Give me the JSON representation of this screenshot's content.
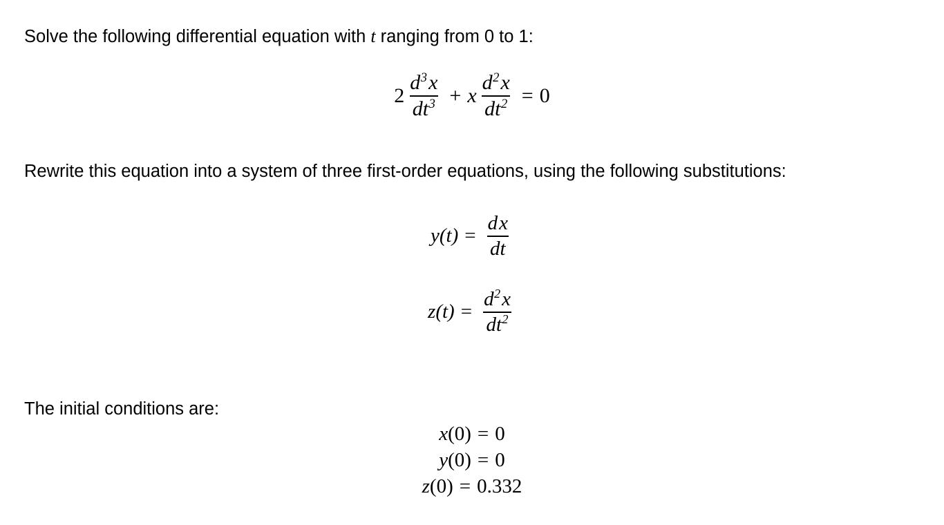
{
  "document": {
    "background_color": "#ffffff",
    "text_color": "#000000",
    "intro": {
      "before_var": "Solve the following differential equation with ",
      "variable": "t",
      "after_var": " ranging from 0 to 1:"
    },
    "main_equation": {
      "coefficient": "2",
      "term1": {
        "numerator_d": "d",
        "numerator_exp": "3",
        "numerator_var": "x",
        "denominator_dt": "dt",
        "denominator_exp": "3"
      },
      "operator": "+",
      "multiplier": "x",
      "term2": {
        "numerator_d": "d",
        "numerator_exp": "2",
        "numerator_var": "x",
        "denominator_dt": "dt",
        "denominator_exp": "2"
      },
      "equals": "=",
      "rhs": "0",
      "plain_text": "2 d3x/dt3 + x d2x/dt2 = 0"
    },
    "rewrite_paragraph": "Rewrite this equation into a system of three first-order equations, using the following substitutions:",
    "substitutions": [
      {
        "lhs": "y(t)",
        "lhs_func": "y",
        "lhs_arg": "(t)",
        "equals": "=",
        "numerator_d": "d",
        "numerator_exp": "",
        "numerator_var": "x",
        "denominator_dt": "dt",
        "denominator_exp": "",
        "plain_text": "y(t) = dx/dt"
      },
      {
        "lhs": "z(t)",
        "lhs_func": "z",
        "lhs_arg": "(t)",
        "equals": "=",
        "numerator_d": "d",
        "numerator_exp": "2",
        "numerator_var": "x",
        "denominator_dt": "dt",
        "denominator_exp": "2",
        "plain_text": "z(t) = d2x/dt2"
      }
    ],
    "initial_conditions_label": "The initial conditions are:",
    "initial_conditions": [
      {
        "func": "x",
        "arg": "(0)",
        "equals": "=",
        "value": "0",
        "plain_text": "x(0) = 0"
      },
      {
        "func": "y",
        "arg": "(0)",
        "equals": "=",
        "value": "0",
        "plain_text": "y(0) = 0"
      },
      {
        "func": "z",
        "arg": "(0)",
        "equals": "=",
        "value": "0.332",
        "plain_text": "z(0) = 0.332"
      }
    ]
  }
}
